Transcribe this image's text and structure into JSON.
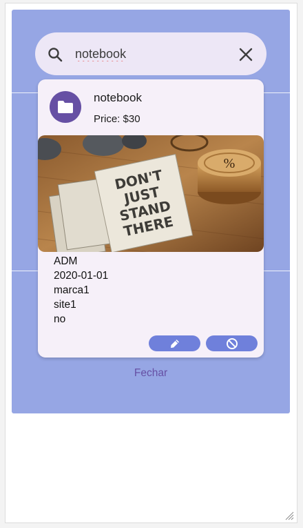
{
  "search": {
    "value": "notebook",
    "search_icon": "search-icon",
    "clear_icon": "close-icon"
  },
  "card": {
    "avatar_icon": "folder-icon",
    "title": "notebook",
    "subtitle": "Price: $30",
    "image": {
      "description_icon": "notebook-photo",
      "text_lines": [
        "DON'T",
        "JUST",
        "STAND",
        "THERE"
      ]
    },
    "details": [
      "ADM",
      "2020-01-01",
      "marca1",
      "site1",
      "no"
    ],
    "edit_icon": "pencil-icon",
    "disable_icon": "block-icon"
  },
  "footer": {
    "close_label": "Fechar"
  },
  "colors": {
    "panel": "#96a6e4",
    "search_bg": "#ede7f6",
    "card_bg": "#f6f0f9",
    "avatar": "#6650a4",
    "action_button": "#6f80db",
    "link": "#6650a4"
  }
}
